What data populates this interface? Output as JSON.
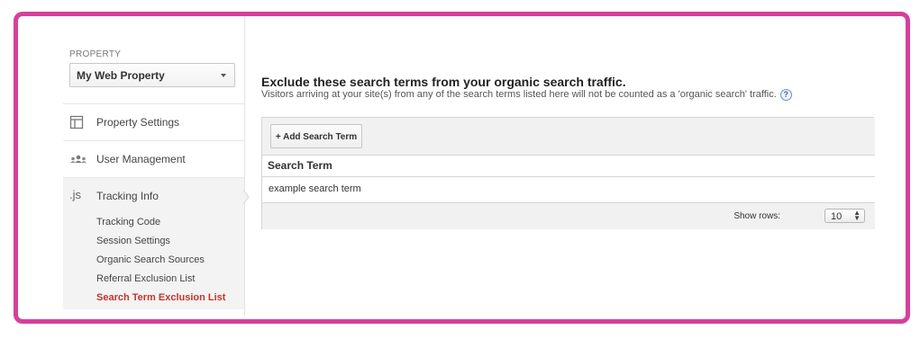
{
  "sidebar": {
    "property_label": "PROPERTY",
    "property_value": "My Web Property",
    "items": [
      {
        "label": "Property Settings",
        "icon": "layout-icon"
      },
      {
        "label": "User Management",
        "icon": "users-icon"
      },
      {
        "label": "Tracking Info",
        "icon": "js-icon",
        "icon_text": ".js"
      }
    ],
    "sub_items": [
      {
        "label": "Tracking Code"
      },
      {
        "label": "Session Settings"
      },
      {
        "label": "Organic Search Sources"
      },
      {
        "label": "Referral Exclusion List"
      },
      {
        "label": "Search Term Exclusion List",
        "active": true
      }
    ]
  },
  "main": {
    "title": "Exclude these search terms from your organic search traffic.",
    "subtitle": "Visitors arriving at your site(s) from any of the search terms listed here will not be counted as a 'organic search' traffic.",
    "help_glyph": "?",
    "add_button": "+ Add Search Term",
    "column_header": "Search Term",
    "rows": [
      {
        "term": "example search term"
      }
    ],
    "show_rows_label": "Show rows:",
    "show_rows_value": "10"
  },
  "colors": {
    "frame": "#d6409a",
    "active_link": "#c3352b"
  }
}
